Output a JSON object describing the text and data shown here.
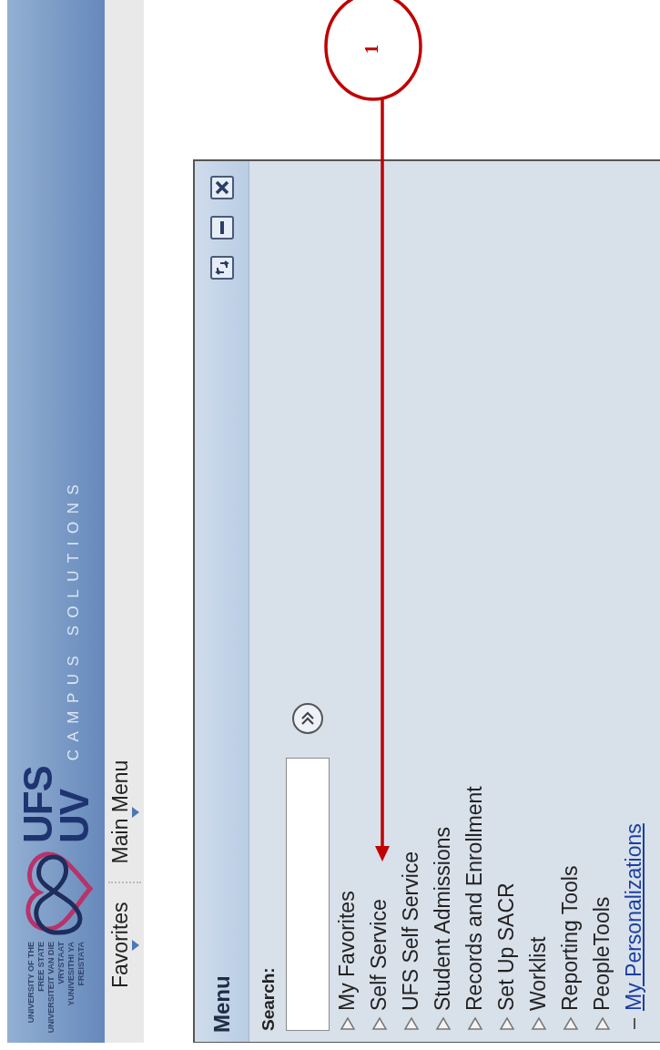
{
  "header": {
    "logo_caption": [
      "UNIVERSITY OF THE",
      "FREE STATE",
      "UNIVERSITEIT VAN DIE",
      "VRYSTAAT",
      "YUNIVESITHI YA",
      "FREISTATA"
    ],
    "logo_text": [
      "UFS",
      "UV"
    ],
    "product": "CAMPUS SOLUTIONS"
  },
  "nav": [
    {
      "label": "Favorites"
    },
    {
      "label": "Main Menu"
    }
  ],
  "menu_panel": {
    "title": "Menu",
    "search": {
      "label": "Search:"
    },
    "items": [
      {
        "label": "My Favorites",
        "kind": "folder"
      },
      {
        "label": "Self Service",
        "kind": "folder"
      },
      {
        "label": "UFS Self Service",
        "kind": "folder"
      },
      {
        "label": "Student Admissions",
        "kind": "folder"
      },
      {
        "label": "Records and Enrollment",
        "kind": "folder"
      },
      {
        "label": "Set Up SACR",
        "kind": "folder"
      },
      {
        "label": "Worklist",
        "kind": "folder"
      },
      {
        "label": "Reporting Tools",
        "kind": "folder"
      },
      {
        "label": "PeopleTools",
        "kind": "folder"
      },
      {
        "label": "My Personalizations",
        "kind": "link"
      }
    ]
  },
  "annotation": {
    "number": "1"
  }
}
